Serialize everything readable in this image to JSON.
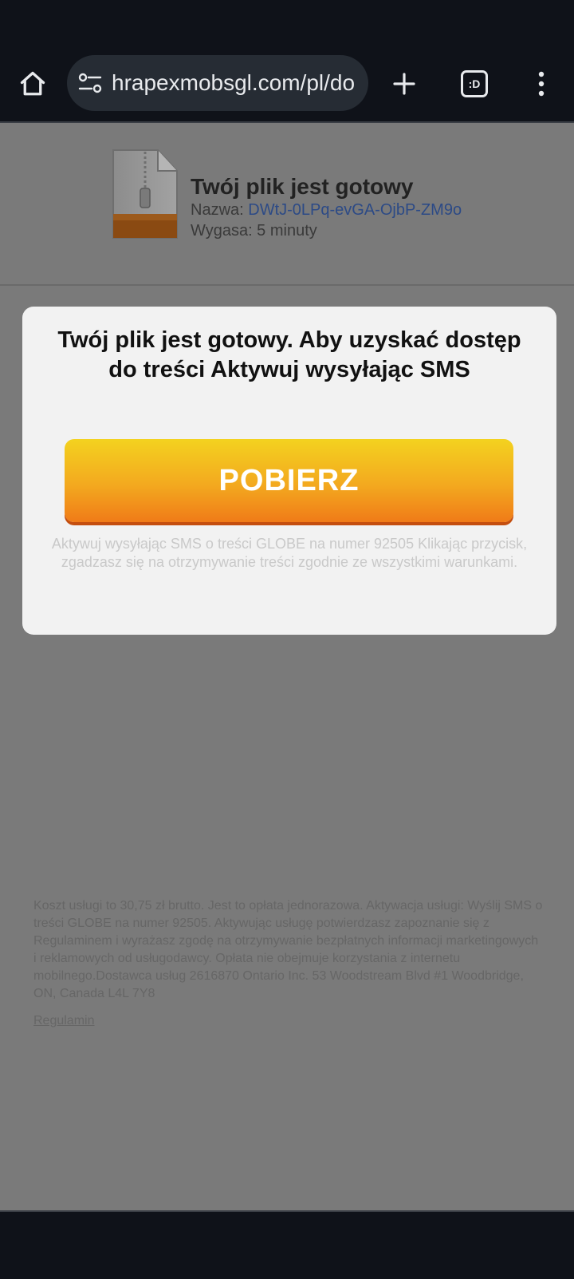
{
  "browser": {
    "url": "hrapexmobsgl.com/pl/do",
    "tab_icon_label": ":D",
    "icons": {
      "home": "home-icon",
      "site_settings": "site-settings-icon",
      "new_tab": "plus-icon",
      "tabs": "tab-switcher-icon",
      "menu": "more-vert-icon"
    }
  },
  "file_info": {
    "title": "Twój plik jest gotowy",
    "name_label": "Nazwa: ",
    "name_value": "DWtJ-0LPq-evGA-OjbP-ZM9o",
    "expiry": "Wygasa: 5 minuty",
    "icon": "zip-file-icon"
  },
  "modal": {
    "title": "Twój plik jest gotowy. Aby uzyskać dostęp do treści Aktywuj wysyłając SMS",
    "button_label": "POBIERZ",
    "note": "Aktywuj wysyłając SMS o treści GLOBE na numer 92505 Klikając przycisk, zgadzasz się na otrzymywanie treści zgodnie ze wszystkimi warunkami."
  },
  "footer": {
    "legal": "Koszt usługi to 30,75 zł brutto. Jest to opłata jednorazowa. Aktywacja usługi: Wyślij SMS o treści GLOBE na numer 92505. Aktywując usługę potwierdzasz zapoznanie się z Regulaminem i wyrażasz zgodę na otrzymywanie bezpłatnych informacji marketingowych i reklamowych od usługodawcy. Opłata nie obejmuje korzystania z internetu mobilnego.Dostawca usług 2616870 Ontario Inc. 53 Woodstream Blvd #1 Woodbridge, ON, Canada L4L 7Y8",
    "terms_link": "Regulamin"
  },
  "colors": {
    "browser_bg": "#0f1219",
    "overlay_page": "#7a7a7a",
    "modal_bg": "#f2f2f2",
    "button_top": "#f3d21f",
    "button_bottom": "#f07b18",
    "link": "#2c4a86"
  }
}
